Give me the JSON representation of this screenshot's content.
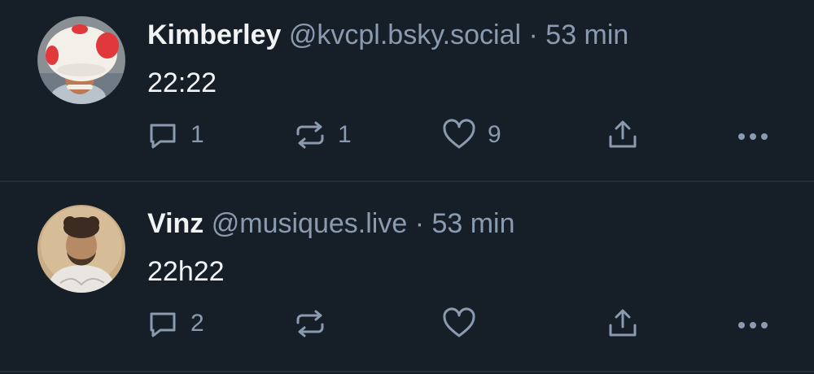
{
  "colors": {
    "background": "#161e27",
    "divider": "#232e3b",
    "primary_text": "#f1f3f5",
    "secondary_text": "#8a9bb0"
  },
  "posts": [
    {
      "author_name": "Kimberley",
      "handle": "@kvcpl.bsky.social",
      "separator": "·",
      "time": "53 min",
      "text": "22:22",
      "avatar_icon": "avatar-mushroom-hat",
      "reply_count": "1",
      "repost_count": "1",
      "like_count": "9"
    },
    {
      "author_name": "Vinz",
      "handle": "@musiques.live",
      "separator": "·",
      "time": "53 min",
      "text": "22h22",
      "avatar_icon": "avatar-vintage-portrait",
      "reply_count": "2",
      "repost_count": "",
      "like_count": ""
    }
  ],
  "icons": {
    "reply": "reply-icon",
    "repost": "repost-icon",
    "like": "heart-icon",
    "share": "share-icon",
    "more": "more-icon"
  }
}
